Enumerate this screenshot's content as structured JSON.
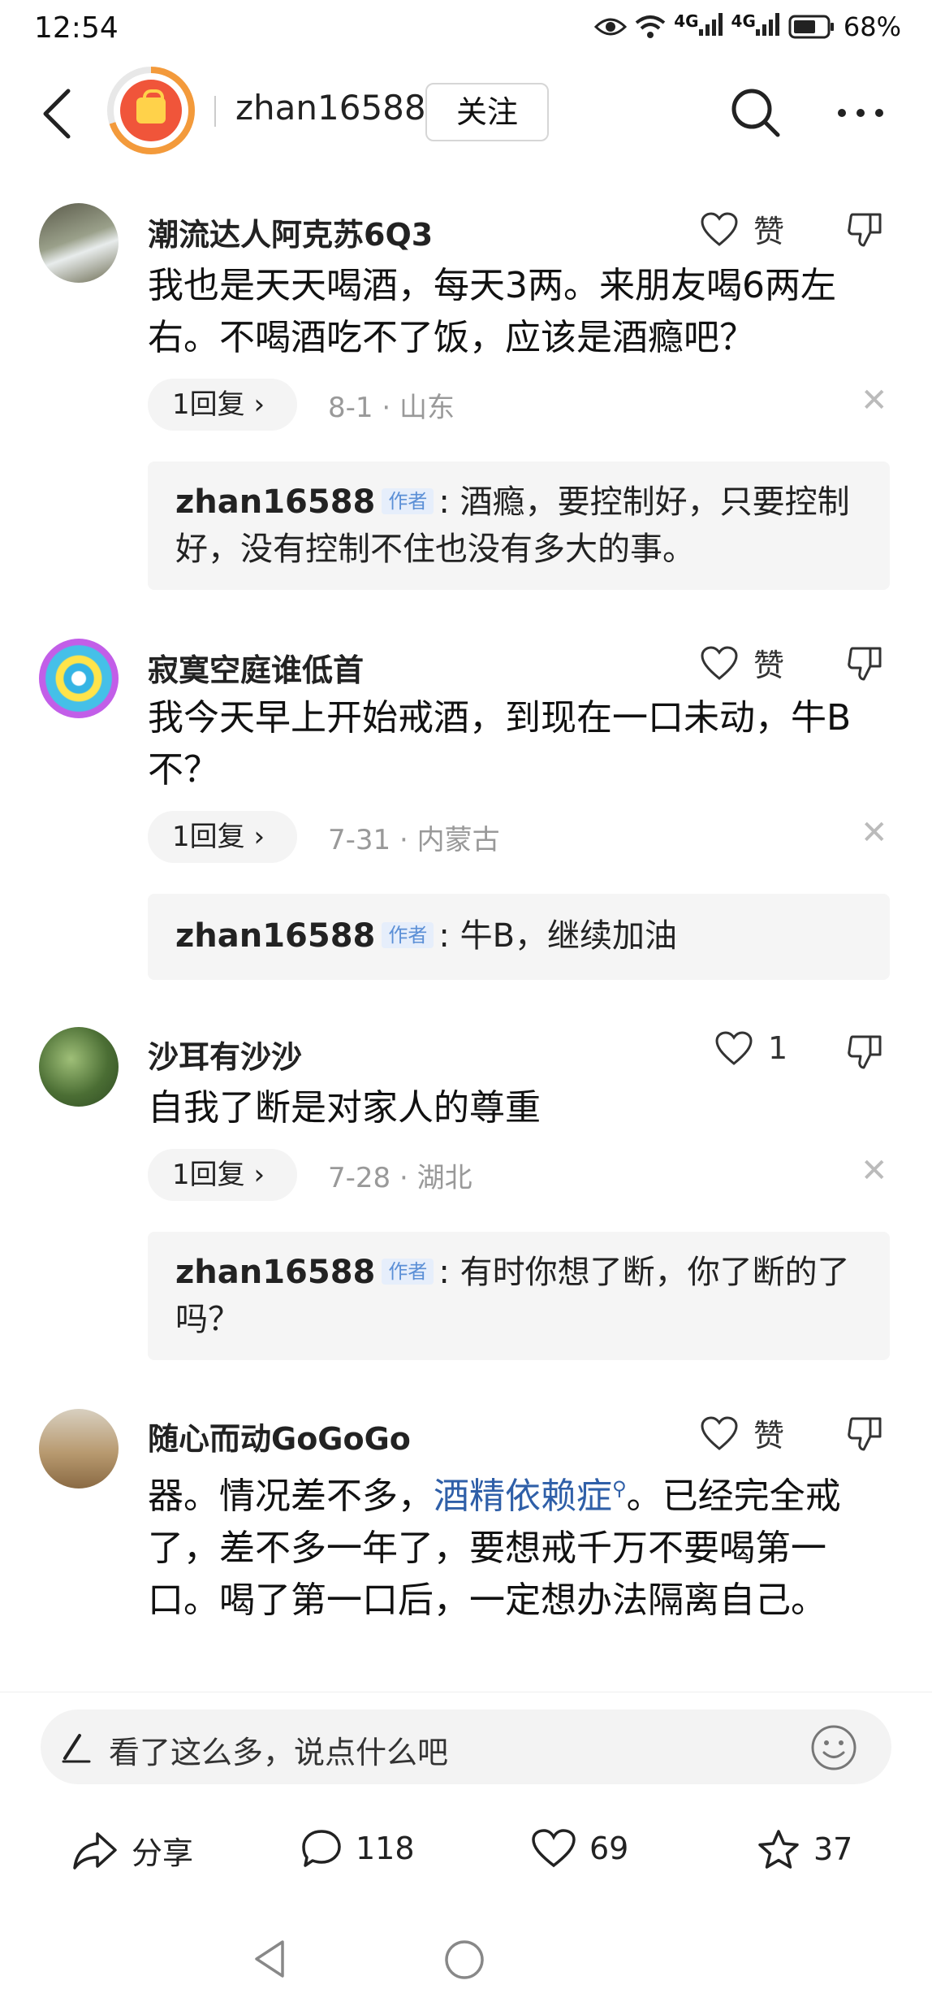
{
  "status_bar": {
    "time": "12:54",
    "signal_1": "4G",
    "signal_2": "4G",
    "battery": "68%"
  },
  "header": {
    "username": "zhan16588",
    "follow_label": "关注"
  },
  "comments": [
    {
      "name": "潮流达人阿克苏6Q3",
      "text": "我也是天天喝酒，每天3两。来朋友喝6两左右。不喝酒吃不了饭，应该是酒瘾吧？",
      "like_label": "赞",
      "reply_label": "1回复 ›",
      "meta": "8-1 · 山东",
      "reply": {
        "author": "zhan16588",
        "tag": "作者",
        "text": ": 酒瘾，要控制好，只要控制好，没有控制不住也没有多大的事。"
      }
    },
    {
      "name": "寂寞空庭谁低首",
      "text": "我今天早上开始戒酒，到现在一口未动，牛B不？",
      "like_label": "赞",
      "reply_label": "1回复 ›",
      "meta": "7-31 · 内蒙古",
      "reply": {
        "author": "zhan16588",
        "tag": "作者",
        "text": ": 牛B，继续加油"
      }
    },
    {
      "name": "沙耳有沙沙",
      "text": "自我了断是对家人的尊重",
      "like_label": "1",
      "reply_label": "1回复 ›",
      "meta": "7-28 · 湖北",
      "reply": {
        "author": "zhan16588",
        "tag": "作者",
        "text": ": 有时你想了断，你了断的了吗？"
      }
    },
    {
      "name": "随心而动GoGoGo",
      "text_before": "器。情况差不多，",
      "link": "酒精依赖症",
      "text_after": "。已经完全戒了，差不多一年了，要想戒千万不要喝第一口。喝了第一口后，一定想办法隔离自己。",
      "like_label": "赞"
    }
  ],
  "input": {
    "placeholder": "看了这么多，说点什么吧"
  },
  "actions": {
    "share": "分享",
    "comments": "118",
    "likes": "69",
    "favorites": "37"
  }
}
